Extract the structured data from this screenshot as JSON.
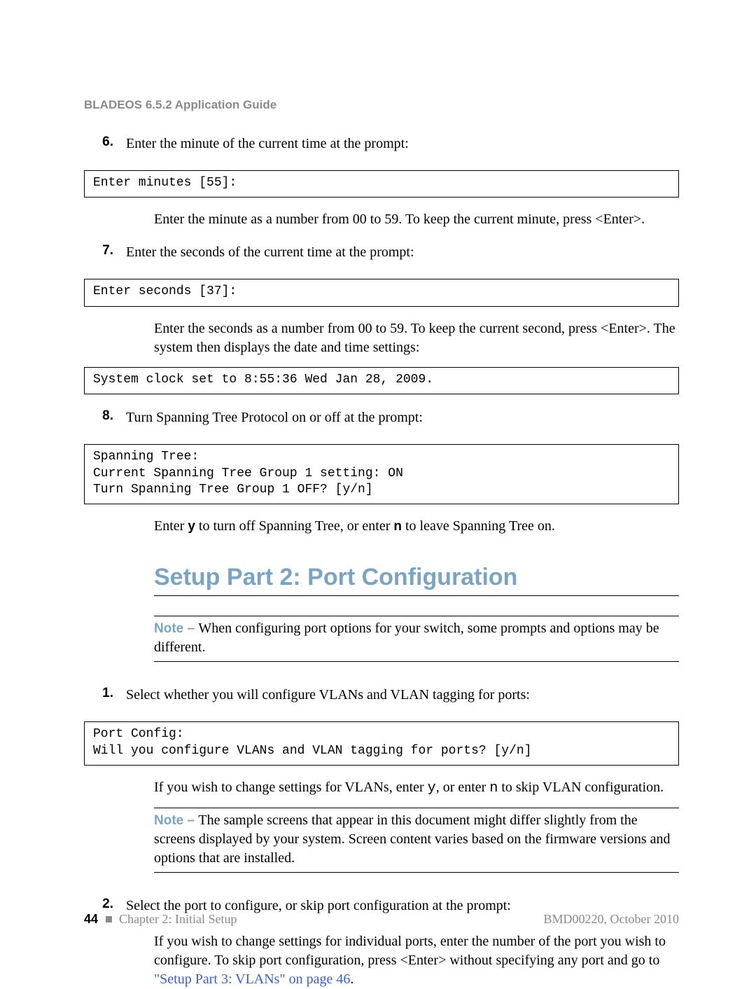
{
  "header": "BLADEOS 6.5.2 Application Guide",
  "steps": {
    "s6": {
      "num": "6.",
      "intro": "Enter the minute of the current time at the prompt:",
      "code": "Enter minutes [55]:",
      "after": "Enter the minute as a number from 00 to 59. To keep the current minute, press <Enter>."
    },
    "s7": {
      "num": "7.",
      "intro": "Enter the seconds of the current time at the prompt:",
      "code": "Enter seconds [37]:",
      "after1": "Enter the seconds as a number from 00 to 59. To keep the current second, press <Enter>. The system then displays the date and time settings:",
      "code2": "System clock set to 8:55:36 Wed Jan 28, 2009."
    },
    "s8": {
      "num": "8.",
      "intro": "Turn Spanning Tree Protocol on or off at the prompt:",
      "code": "Spanning Tree:\nCurrent Spanning Tree Group 1 setting: ON\nTurn Spanning Tree Group 1 OFF? [y/n]",
      "after_pre": "Enter ",
      "y": "y",
      "after_mid": " to turn off Spanning Tree, or enter ",
      "n": "n",
      "after_post": " to leave Spanning Tree on."
    }
  },
  "section_title": "Setup Part 2: Port Configuration",
  "note1": {
    "label": "Note – ",
    "text": "When configuring port options for your switch, some prompts and options may be different."
  },
  "part2": {
    "s1": {
      "num": "1.",
      "intro": "Select whether you will configure VLANs and VLAN tagging for ports:",
      "code": "Port Config:\nWill you configure VLANs and VLAN tagging for ports? [y/n]",
      "after_pre": "If you wish to change settings for VLANs, enter ",
      "y": "y",
      "after_mid": ", or enter ",
      "n": "n",
      "after_post": " to skip VLAN configuration."
    },
    "note2": {
      "label": "Note – ",
      "text": "The sample screens that appear in this document might differ slightly from the screens displayed by your system. Screen content varies based on the firmware versions and options that are installed."
    },
    "s2": {
      "num": "2.",
      "intro": "Select the port to configure, or skip port configuration at the prompt:",
      "after_pre": "If you wish to change settings for individual ports, enter the number of the port you wish to configure. To skip port configuration, press <Enter> without specifying any port and go to ",
      "link": "\"Setup Part 3: VLANs\" on page 46",
      "after_post": "."
    }
  },
  "footer": {
    "pnum": "44",
    "chapter": "Chapter 2: Initial Setup",
    "doc": "BMD00220, October 2010"
  }
}
